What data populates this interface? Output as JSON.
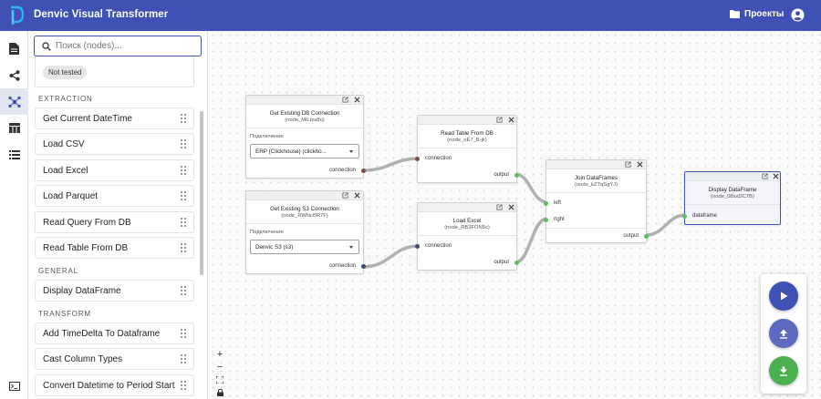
{
  "app": {
    "title": "Denvic Visual Transformer",
    "projects_label": "Проекты"
  },
  "colors": {
    "primary": "#3f51b5",
    "play": "#3f51b5",
    "upload": "#5c6bc0",
    "download": "#4caf50",
    "port_green": "#5dbb63",
    "port_brown": "#7b4f45"
  },
  "rail": {
    "icons": [
      "document-icon",
      "share-icon",
      "graph-icon",
      "table-icon",
      "list-icon",
      "terminal-icon"
    ]
  },
  "search": {
    "placeholder": "Поиск (nodes)..."
  },
  "sidebar": {
    "partial_chip": "Not tested",
    "groups": [
      {
        "label": "EXTRACTION",
        "items": [
          "Get Current DateTime",
          "Load CSV",
          "Load Excel",
          "Load Parquet",
          "Read Query From DB",
          "Read Table From DB"
        ]
      },
      {
        "label": "GENERAL",
        "items": [
          "Display DataFrame"
        ]
      },
      {
        "label": "TRANSFORM",
        "items": [
          "Add TimeDelta To Dataframe",
          "Cast Column Types",
          "Convert Datetime to Period Start"
        ]
      }
    ]
  },
  "nodes": {
    "db_conn": {
      "title": "Get Existing DB Connection",
      "id": "(node_MiLtza8u)",
      "field_label": "Подключение",
      "value": "ERP (Clickhouse) (clickho...",
      "output": "connection"
    },
    "s3_conn": {
      "title": "Get Existing S3 Connection",
      "id": "(node_RWNcBR7F)",
      "field_label": "Подключение",
      "value": "Denvic S3 (s3)",
      "output": "connection"
    },
    "read_table": {
      "title": "Read Table From DB",
      "id": "(node_oE7_B-jk)",
      "input": "connection",
      "output": "output"
    },
    "load_excel": {
      "title": "Load Excel",
      "id": "(node_RB3FON5c)",
      "input": "connection",
      "output": "output"
    },
    "join": {
      "title": "Join DataFrames",
      "id": "(node_kZTqSgYJ)",
      "input_left": "left",
      "input_right": "right",
      "output": "output"
    },
    "display": {
      "title": "Display DataFrame",
      "id": "(node_08sxDC7B)",
      "input": "dataframe"
    }
  },
  "zoom": {
    "plus": "+",
    "minus": "−"
  },
  "fabs": {
    "run_icon": "play-icon",
    "upload_icon": "upload-icon",
    "download_icon": "download-icon"
  }
}
